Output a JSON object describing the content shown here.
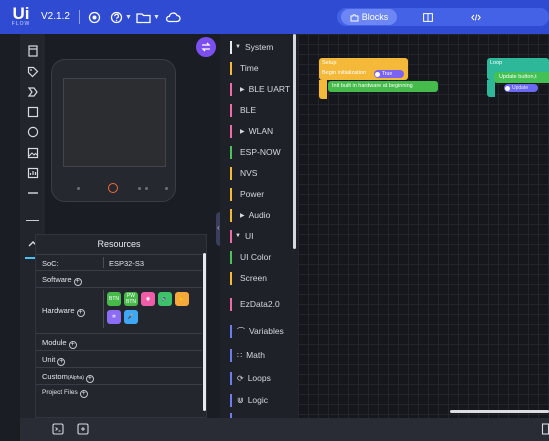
{
  "header": {
    "logo": "UiFlow",
    "logo_main": "Ui",
    "logo_sub": "FLOW",
    "version": "V2.1.2",
    "icons": [
      "settings-icon",
      "help-icon",
      "folder-icon",
      "cloud-icon"
    ],
    "view_tabs": [
      {
        "label": "Blocks",
        "icon": "puzzle-icon",
        "active": true
      },
      {
        "label": "",
        "icon": "split-view-icon",
        "active": false
      },
      {
        "label": "",
        "icon": "code-icon",
        "active": false
      }
    ]
  },
  "toolbar": {
    "tools": [
      "file-icon",
      "tag-icon",
      "arrow-icon",
      "square-icon",
      "circle-icon",
      "image-icon",
      "chart-icon",
      "line-icon",
      "arrow-up-icon"
    ]
  },
  "device": {
    "swap_icon": "swap-icon",
    "power_color": "#f06a35"
  },
  "resources": {
    "title": "Resources",
    "soc_label": "SoC:",
    "soc_value": "ESP32-S3",
    "software_label": "Software",
    "hardware_label": "Hardware",
    "hardware_chips": [
      {
        "label": "BTN",
        "color": "#46b94a"
      },
      {
        "label": "PW BTN",
        "color": "#46b94a"
      },
      {
        "label": "",
        "color": "#ef5da8"
      },
      {
        "label": "",
        "color": "#3ec16b"
      },
      {
        "label": "",
        "color": "#f5a93a"
      },
      {
        "label": "",
        "color": "#8a6cf5"
      },
      {
        "label": "",
        "color": "#3fa8f5"
      }
    ],
    "module_label": "Module",
    "unit_label": "Unit",
    "custom_label": "Custom",
    "custom_tag": "(Alpha)",
    "project_files_label": "Project Files"
  },
  "categories": [
    {
      "label": "System",
      "color": "#e8e9ee",
      "expanded": true,
      "level": 0
    },
    {
      "label": "Time",
      "color": "#f5b93a",
      "level": 1
    },
    {
      "label": "BLE UART",
      "color": "#ef6aa8",
      "level": 1,
      "collapsed": true
    },
    {
      "label": "BLE",
      "color": "#ef6aa8",
      "level": 1
    },
    {
      "label": "WLAN",
      "color": "#ef6aa8",
      "level": 1,
      "collapsed": true
    },
    {
      "label": "ESP-NOW",
      "color": "#4ec15a",
      "level": 1
    },
    {
      "label": "NVS",
      "color": "#f5b93a",
      "level": 1
    },
    {
      "label": "Power",
      "color": "#f5b93a",
      "level": 1
    },
    {
      "label": "Audio",
      "color": "#f5b93a",
      "level": 1,
      "collapsed": true
    },
    {
      "label": "UI",
      "color": "#ef6aa8",
      "expanded": true,
      "level": 0
    },
    {
      "label": "UI Color",
      "color": "#4ec15a",
      "level": 1
    },
    {
      "label": "Screen",
      "color": "#f5b93a",
      "level": 1
    },
    {
      "label": "EzData2.0",
      "color": "#ef6aa8",
      "level": 0
    },
    {
      "label": "Variables",
      "color": "#6f7cf0",
      "level": 0,
      "icon": "variables-icon"
    },
    {
      "label": "Math",
      "color": "#6f7cf0",
      "level": 0,
      "icon": "math-icon"
    },
    {
      "label": "Loops",
      "color": "#6f7cf0",
      "level": 0,
      "icon": "loops-icon"
    },
    {
      "label": "Logic",
      "color": "#6f7cf0",
      "level": 0,
      "icon": "logic-icon"
    }
  ],
  "workspace": {
    "setup": {
      "title": "Setup",
      "text": "Begin initialization",
      "toggle": "True",
      "init": "Init built in hardware at beginning"
    },
    "loop": {
      "title": "Loop",
      "update_text": "Update button,t",
      "update_btn": "Update"
    }
  },
  "bottombar": {
    "icons": [
      "terminal-icon",
      "device-export-icon"
    ]
  }
}
